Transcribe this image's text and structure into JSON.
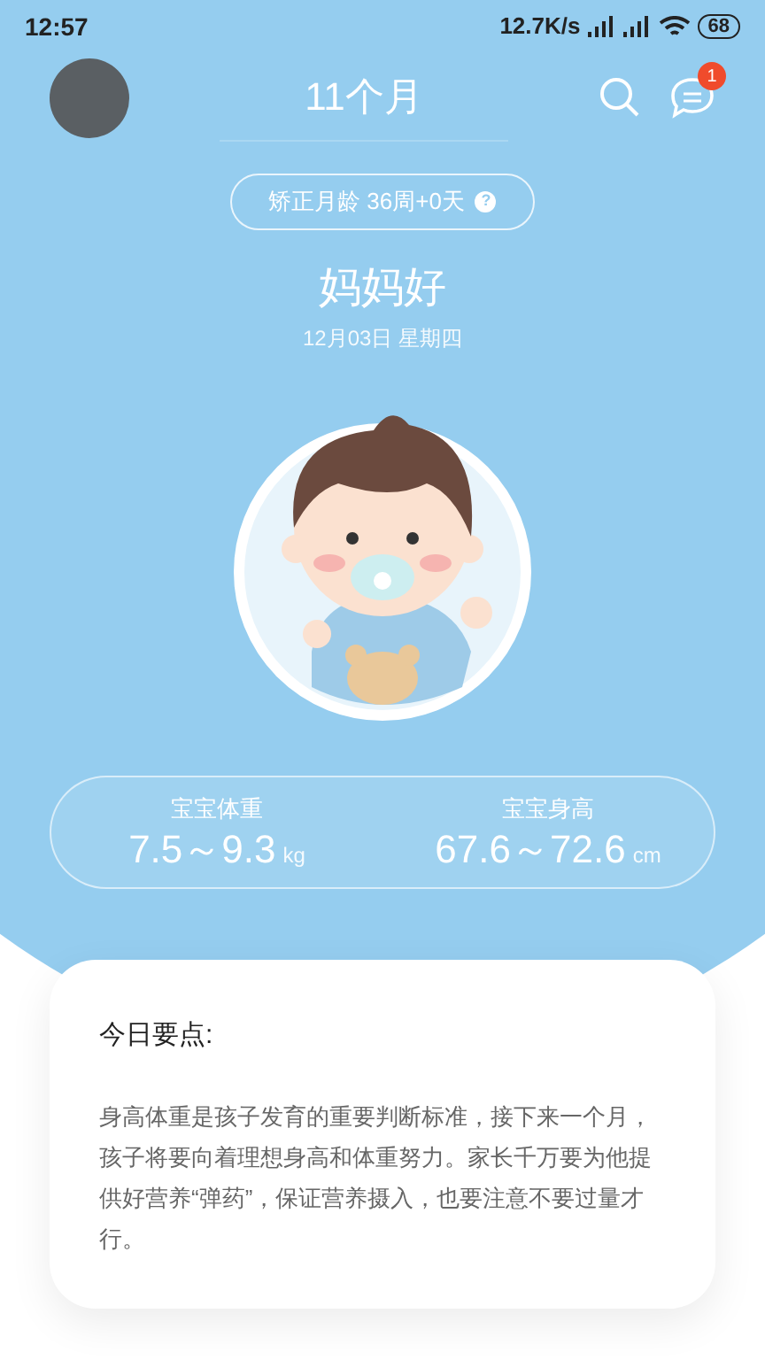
{
  "status_bar": {
    "time": "12:57",
    "network_speed": "12.7K/s",
    "battery": "68"
  },
  "header": {
    "title": "11个月",
    "message_badge": "1"
  },
  "corrected_age": {
    "text": "矫正月龄 36周+0天",
    "help_icon": "?"
  },
  "greeting": "妈妈好",
  "date": "12月03日 星期四",
  "stats": [
    {
      "label": "宝宝体重",
      "value": "7.5～9.3",
      "unit": "kg"
    },
    {
      "label": "宝宝身高",
      "value": "67.6～72.6",
      "unit": "cm"
    }
  ],
  "tip_card": {
    "title": "今日要点:",
    "body": "身高体重是孩子发育的重要判断标准，接下来一个月，孩子将要向着理想身高和体重努力。家长千万要为他提供好营养“弹药”，保证营养摄入，也要注意不要过量才行。"
  }
}
